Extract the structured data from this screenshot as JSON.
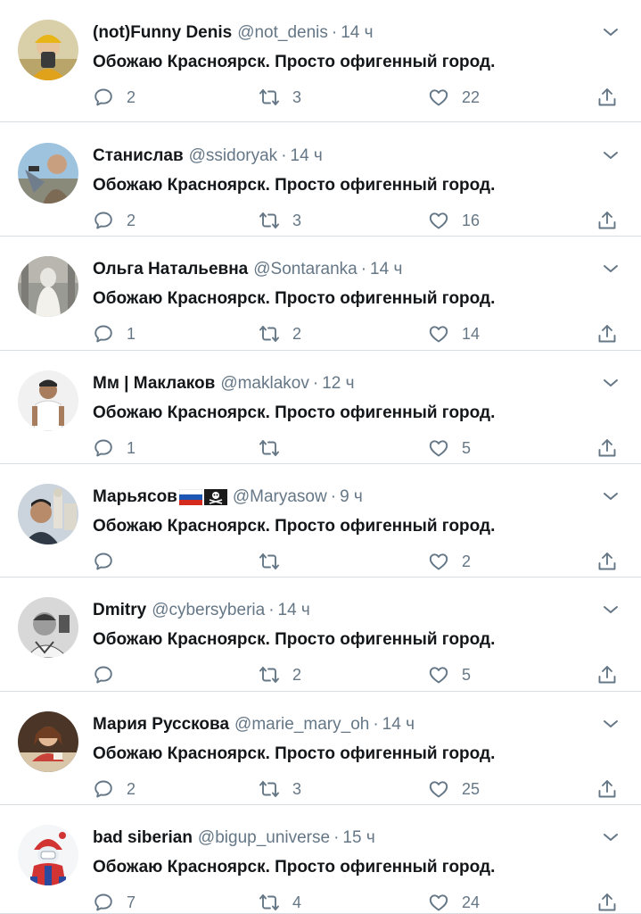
{
  "feed": {
    "tweets": [
      {
        "name": "(not)Funny Denis",
        "handle": "@not_denis",
        "dot": "·",
        "time": "14 ч",
        "text": "Обожаю Красноярск. Просто офигенный город.",
        "replies": "2",
        "retweets": "3",
        "likes": "22",
        "avatar_icon": "person-yellow-hat-avatar",
        "has_flags": false
      },
      {
        "name": "Станислав",
        "handle": "@ssidoryak",
        "dot": "·",
        "time": "14 ч",
        "text": "Обожаю Красноярск. Просто офигенный город.",
        "replies": "2",
        "retweets": "3",
        "likes": "16",
        "avatar_icon": "person-outdoor-avatar",
        "has_flags": false
      },
      {
        "name": "Ольга Натальевна",
        "handle": "@Sontaranka",
        "dot": "·",
        "time": "14 ч",
        "text": "Обожаю Красноярск. Просто офигенный город.",
        "replies": "1",
        "retweets": "2",
        "likes": "14",
        "avatar_icon": "statue-avatar",
        "has_flags": false
      },
      {
        "name": "Мм | Маклаков",
        "handle": "@maklakov",
        "dot": "·",
        "time": "12 ч",
        "text": "Обожаю Красноярск. Просто офигенный город.",
        "replies": "1",
        "retweets": "",
        "likes": "5",
        "avatar_icon": "person-white-shirt-avatar",
        "has_flags": false
      },
      {
        "name": "Марьясов",
        "handle": "@Maryasow",
        "dot": "·",
        "time": "9 ч",
        "text": "Обожаю Красноярск. Просто офигенный город.",
        "replies": "",
        "retweets": "",
        "likes": "2",
        "avatar_icon": "person-city-avatar",
        "has_flags": true
      },
      {
        "name": "Dmitry",
        "handle": "@cybersyberia",
        "dot": "·",
        "time": "14 ч",
        "text": "Обожаю Красноярск. Просто офигенный город.",
        "replies": "",
        "retweets": "2",
        "likes": "5",
        "avatar_icon": "person-bw-avatar",
        "has_flags": false
      },
      {
        "name": "Мария Русскова",
        "handle": "@marie_mary_oh",
        "dot": "·",
        "time": "14 ч",
        "text": "Обожаю Красноярск. Просто офигенный город.",
        "replies": "2",
        "retweets": "3",
        "likes": "25",
        "avatar_icon": "person-cafe-avatar",
        "has_flags": false
      },
      {
        "name": "bad siberian",
        "handle": "@bigup_universe",
        "dot": "·",
        "time": "15 ч",
        "text": "Обожаю Красноярск. Просто офигенный город.",
        "replies": "7",
        "retweets": "4",
        "likes": "24",
        "avatar_icon": "masked-cartoon-avatar",
        "has_flags": false
      }
    ]
  },
  "icons": {
    "reply": "speech-bubble-icon",
    "retweet": "retweet-arrows-icon",
    "like": "heart-icon",
    "share": "share-upload-icon",
    "caret": "chevron-down-icon",
    "flag": "russia-flag-icon",
    "pirate": "pirate-flag-icon"
  },
  "colors": {
    "text": "#14171a",
    "muted": "#657786",
    "divider": "#d8dde2",
    "icon": "#657786"
  }
}
